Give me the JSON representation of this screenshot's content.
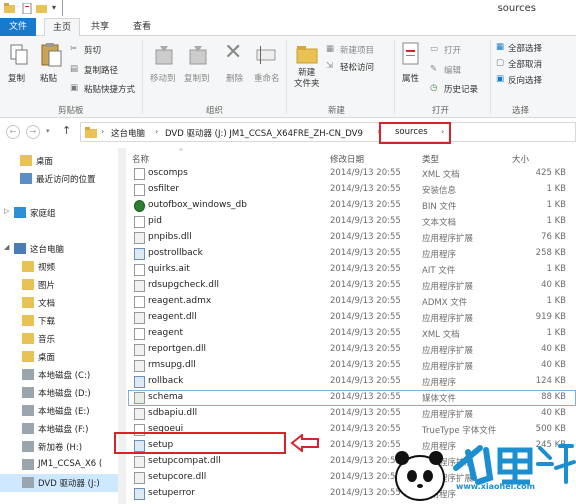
{
  "window": {
    "title": "sources"
  },
  "tabs": {
    "file": "文件",
    "home": "主页",
    "share": "共享",
    "view": "查看"
  },
  "ribbon": {
    "copy": "复制",
    "paste": "粘贴",
    "cut": "剪切",
    "copy_path": "复制路径",
    "paste_shortcut": "粘贴快捷方式",
    "clipboard_group": "剪贴板",
    "move_to": "移动到",
    "copy_to": "复制到",
    "delete": "删除",
    "rename": "重命名",
    "organize_group": "组织",
    "new_folder": "新建\n文件夹",
    "new_item": "新建项目",
    "easy_access": "轻松访问",
    "new_group": "新建",
    "properties": "属性",
    "open": "打开",
    "edit": "编辑",
    "history": "历史记录",
    "open_group": "打开",
    "select_all": "全部选择",
    "select_none": "全部取消",
    "invert_selection": "反向选择",
    "select_group": "选择"
  },
  "address": {
    "crumbs": [
      "这台电脑",
      "DVD 驱动器 (J:) JM1_CCSA_X64FRE_ZH-CN_DV9",
      "sources"
    ]
  },
  "nav": {
    "items": [
      "桌面",
      "最近访问的位置",
      "家庭组",
      "这台电脑",
      "视频",
      "图片",
      "文档",
      "下载",
      "音乐",
      "桌面",
      "本地磁盘 (C:)",
      "本地磁盘 (D:)",
      "本地磁盘 (E:)",
      "本地磁盘 (F:)",
      "新加卷 (H:)",
      "JM1_CCSA_X6 (",
      "DVD 驱动器 (J:)"
    ]
  },
  "columns": {
    "name": "名称",
    "date": "修改日期",
    "type": "类型",
    "size": "大小"
  },
  "files": [
    {
      "name": "oscomps",
      "date": "2014/9/13 20:55",
      "type": "XML 文档",
      "size": "425 KB"
    },
    {
      "name": "osfilter",
      "date": "2014/9/13 20:55",
      "type": "安装信息",
      "size": "1 KB"
    },
    {
      "name": "outofbox_windows_db",
      "date": "2014/9/13 20:55",
      "type": "BIN 文件",
      "size": "1 KB"
    },
    {
      "name": "pid",
      "date": "2014/9/13 20:55",
      "type": "文本文档",
      "size": "1 KB"
    },
    {
      "name": "pnpibs.dll",
      "date": "2014/9/13 20:55",
      "type": "应用程序扩展",
      "size": "76 KB"
    },
    {
      "name": "postrollback",
      "date": "2014/9/13 20:55",
      "type": "应用程序",
      "size": "258 KB"
    },
    {
      "name": "quirks.ait",
      "date": "2014/9/13 20:55",
      "type": "AIT 文件",
      "size": "1 KB"
    },
    {
      "name": "rdsupgcheck.dll",
      "date": "2014/9/13 20:55",
      "type": "应用程序扩展",
      "size": "40 KB"
    },
    {
      "name": "reagent.admx",
      "date": "2014/9/13 20:55",
      "type": "ADMX 文件",
      "size": "1 KB"
    },
    {
      "name": "reagent.dll",
      "date": "2014/9/13 20:55",
      "type": "应用程序扩展",
      "size": "919 KB"
    },
    {
      "name": "reagent",
      "date": "2014/9/13 20:55",
      "type": "XML 文档",
      "size": "1 KB"
    },
    {
      "name": "reportgen.dll",
      "date": "2014/9/13 20:55",
      "type": "应用程序扩展",
      "size": "40 KB"
    },
    {
      "name": "rmsupg.dll",
      "date": "2014/9/13 20:55",
      "type": "应用程序扩展",
      "size": "40 KB"
    },
    {
      "name": "rollback",
      "date": "2014/9/13 20:55",
      "type": "应用程序",
      "size": "124 KB"
    },
    {
      "name": "schema",
      "date": "2014/9/13 20:55",
      "type": "媒体文件",
      "size": "88 KB"
    },
    {
      "name": "sdbapiu.dll",
      "date": "2014/9/13 20:55",
      "type": "应用程序扩展",
      "size": "40 KB"
    },
    {
      "name": "segoeui",
      "date": "2014/9/13 20:55",
      "type": "TrueType 字体文件",
      "size": "500 KB"
    },
    {
      "name": "setup",
      "date": "2014/9/13 20:55",
      "type": "应用程序",
      "size": "245 KB"
    },
    {
      "name": "setupcompat.dll",
      "date": "2014/9/13 20:55",
      "type": "应用程序扩展",
      "size": ""
    },
    {
      "name": "setupcore.dll",
      "date": "2014/9/13 20:55",
      "type": "应用程序扩展",
      "size": ""
    },
    {
      "name": "setuperror",
      "date": "2014/9/13 20:55",
      "type": "应用程序",
      "size": ""
    }
  ],
  "watermark": {
    "text": "www.xiaohei.com",
    "logo": "小黑游戏"
  },
  "colors": {
    "accent": "#1979ca",
    "highlight": "#d9232a",
    "folder": "#e8c254",
    "selection": "#cde8ff"
  }
}
